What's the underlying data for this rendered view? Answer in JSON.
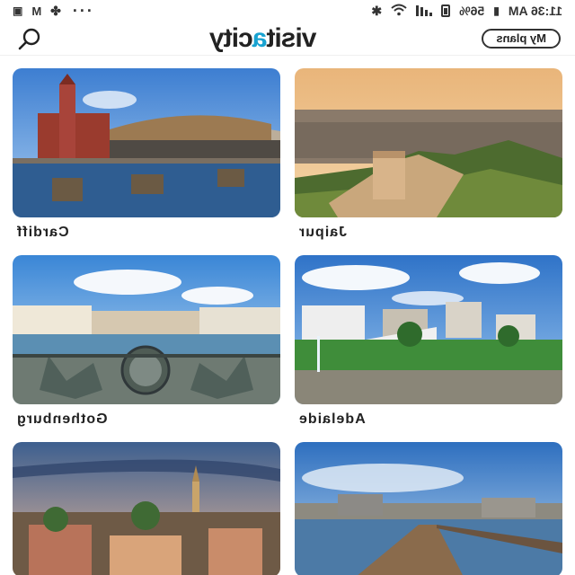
{
  "status_bar": {
    "time": "11:36 AM",
    "battery": "56%",
    "overflow": "···"
  },
  "header": {
    "logo_part1": "visit",
    "logo_accent": "a",
    "logo_part2": "city",
    "my_plans_label": "My plans",
    "search_icon": "search-icon"
  },
  "cities": [
    {
      "name": "Jaipur"
    },
    {
      "name": "Cardiff"
    },
    {
      "name": "Adelaide"
    },
    {
      "name": "Gothenburg"
    },
    {
      "name": ""
    },
    {
      "name": ""
    }
  ],
  "colors": {
    "accent": "#19a3d1",
    "text": "#222222"
  }
}
